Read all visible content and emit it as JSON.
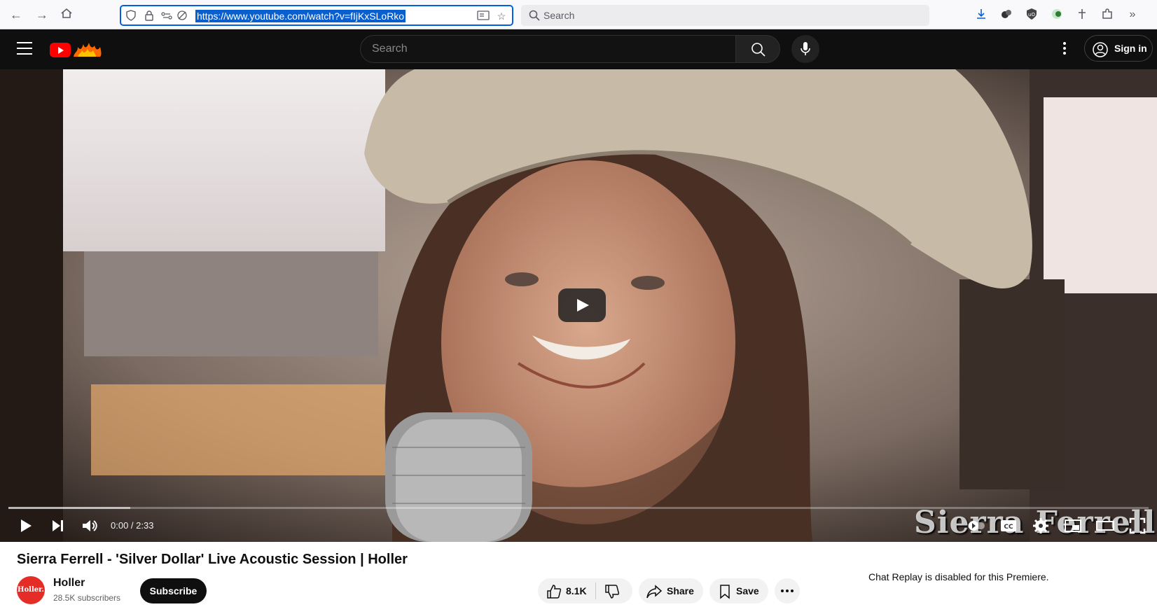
{
  "browser": {
    "url": "https://www.youtube.com/watch?v=fIjKxSLoRko",
    "search_placeholder": "Search"
  },
  "header": {
    "search_placeholder": "Search",
    "signin_label": "Sign in"
  },
  "video": {
    "time_display": "0:00 / 2:33",
    "watermark": "Sierra Ferrell",
    "buffered_fraction": 0.107
  },
  "details": {
    "title": "Sierra Ferrell - 'Silver Dollar' Live Acoustic Session | Holler",
    "channel_name": "Holler",
    "channel_avatar_text": "Holler.",
    "subscribers": "28.5K subscribers",
    "subscribe_label": "Subscribe",
    "likes": "8.1K",
    "share_label": "Share",
    "save_label": "Save"
  },
  "chat": {
    "note": "Chat Replay is disabled for this Premiere."
  }
}
